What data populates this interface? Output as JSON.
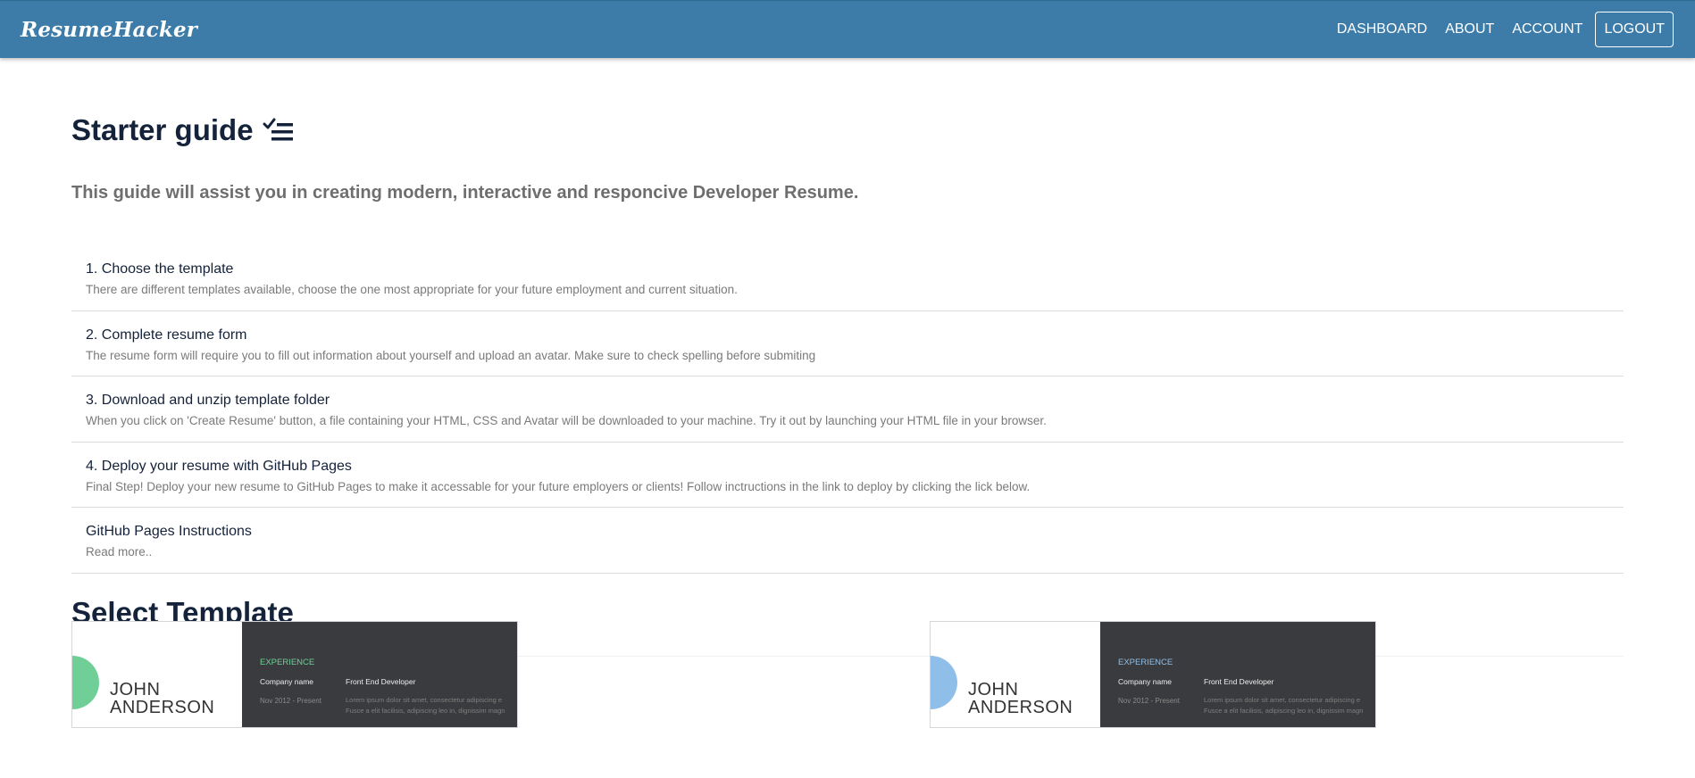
{
  "navbar": {
    "brand": "ResumeHacker",
    "links": [
      "DASHBOARD",
      "ABOUT",
      "ACCOUNT"
    ],
    "logout": "LOGOUT"
  },
  "guide": {
    "title": "Starter guide",
    "icon": "checklist-icon",
    "lead": "This guide will assist you in creating modern, interactive and responcive Developer Resume.",
    "steps": [
      {
        "title": "1. Choose the template",
        "desc": "There are different templates available, choose the one most appropriate for your future employment and current situation."
      },
      {
        "title": "2. Complete resume form",
        "desc": "The resume form will require you to fill out information about yourself and upload an avatar. Make sure to check spelling before submiting"
      },
      {
        "title": "3. Download and unzip template folder",
        "desc": "When you click on 'Create Resume' button, a file containing your HTML, CSS and Avatar will be downloaded to your machine. Try it out by launching your HTML file in your browser."
      },
      {
        "title": "4. Deploy your resume with GitHub Pages",
        "desc": "Final Step! Deploy your new resume to GitHub Pages to make it accessable for your future employers or clients! Follow inctructions in the link to deploy by clicking the lick below."
      },
      {
        "title": "GitHub Pages Instructions",
        "desc": "Read more.."
      }
    ]
  },
  "templates": {
    "title": "Select Template",
    "cards": [
      {
        "first_name": "JOHN",
        "last_name": "ANDERSON",
        "section": "EXPERIENCE",
        "company": "Company name",
        "role": "Front End Developer",
        "date": "Nov 2012 - Present",
        "lorem1": "Lorem ipsum dolor sit amet, consectetur adipiscing e",
        "lorem2": "Fusce a elit facilisis, adipiscing leo in, dignissim magn",
        "accent": "#6fcf97"
      },
      {
        "first_name": "JOHN",
        "last_name": "ANDERSON",
        "section": "EXPERIENCE",
        "company": "Company name",
        "role": "Front End Developer",
        "date": "Nov 2012 - Present",
        "lorem1": "Lorem ipsum dolor sit amet, consectetur adipiscing e",
        "lorem2": "Fusce a elit facilisis, adipiscing leo in, dignissim magn",
        "accent": "#8fbfe8"
      }
    ]
  },
  "colors": {
    "navbar": "#3d7ca8",
    "heading": "#14223a",
    "muted": "#7a7a7a"
  }
}
